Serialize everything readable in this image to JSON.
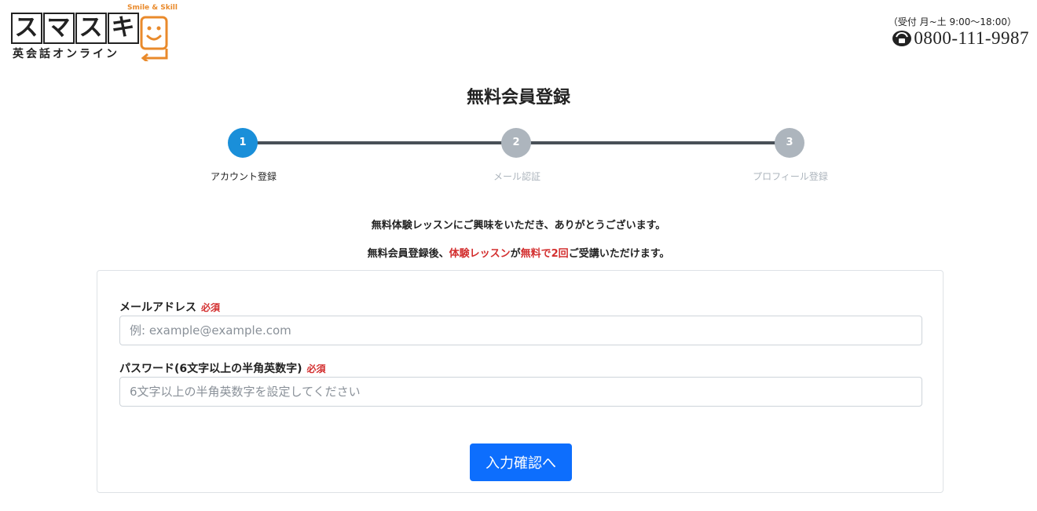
{
  "header": {
    "logo_main": [
      "ス",
      "マ",
      "ス",
      "キ"
    ],
    "logo_sub": "英会話オンライン",
    "logo_tag": "Smile & Skill",
    "hours": "（受付 月~土 9:00～18:00）",
    "phone": "0800-111-9987",
    "brand_color": "#e98a2b"
  },
  "page": {
    "title": "無料会員登録"
  },
  "stepper": {
    "steps": [
      {
        "number": "1",
        "label": "アカウント登録",
        "state": "active"
      },
      {
        "number": "2",
        "label": "メール認証",
        "state": "inactive"
      },
      {
        "number": "3",
        "label": "プロフィール登録",
        "state": "inactive"
      }
    ],
    "active_color": "#1a8fd9",
    "inactive_color": "#adb5bd"
  },
  "intro": {
    "line1": "無料体験レッスンにご興味をいただき、ありがとうございます。",
    "line2_a": "無料会員登録後、",
    "line2_b": "体験レッスン",
    "line2_c": "が",
    "line2_d": "無料で2回",
    "line2_e": "ご受講いただけます。"
  },
  "form": {
    "email": {
      "label": "メールアドレス",
      "required": "必須",
      "placeholder": "例: example@example.com",
      "value": ""
    },
    "password": {
      "label": "パスワード(6文字以上の半角英数字)",
      "required": "必須",
      "placeholder": "6文字以上の半角英数字を設定してください",
      "value": ""
    },
    "submit_label": "入力確認へ",
    "submit_color": "#0d6efd"
  }
}
